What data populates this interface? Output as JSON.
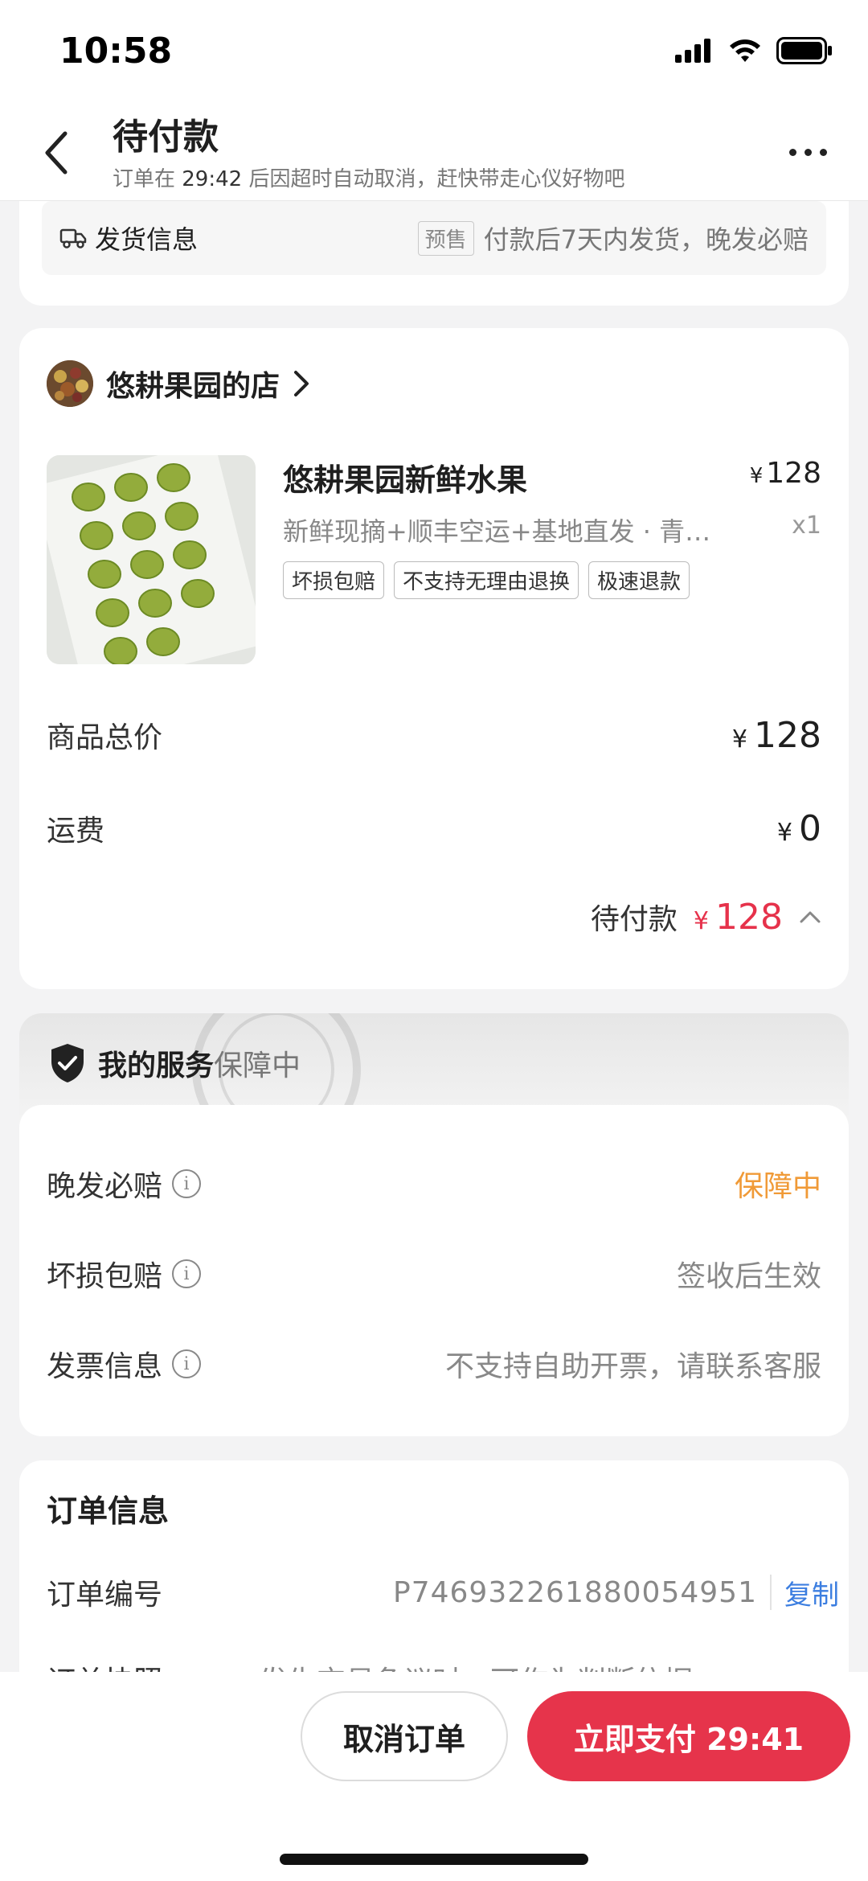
{
  "status_bar": {
    "time": "10:58"
  },
  "header": {
    "title": "待付款",
    "subtitle_prefix": "订单在 ",
    "subtitle_countdown": "29:42",
    "subtitle_suffix": " 后因超时自动取消，赶快带走心仪好物吧"
  },
  "shipping": {
    "label": "发货信息",
    "badge": "预售",
    "text": "付款后7天内发货，晚发必赔"
  },
  "shop": {
    "name": "悠耕果园的店",
    "product": {
      "title": "悠耕果园新鲜水果",
      "currency": "¥",
      "price": "128",
      "desc": "新鲜现摘+顺丰空运+基地直发 · 青皮无花果",
      "qty": "x1",
      "tags": [
        "坏损包赔",
        "不支持无理由退换",
        "极速退款"
      ]
    },
    "summary": {
      "total_label": "商品总价",
      "total_value": "128",
      "shipping_label": "运费",
      "shipping_value": "0",
      "pending_label": "待付款",
      "pending_value": "128",
      "currency": "¥"
    }
  },
  "service": {
    "title": "我的服务",
    "status": "保障中",
    "rows": [
      {
        "label": "晚发必赔",
        "value": "保障中"
      },
      {
        "label": "坏损包赔",
        "value": "签收后生效"
      },
      {
        "label": "发票信息",
        "value": "不支持自助开票，请联系客服"
      }
    ],
    "info_glyph": "i"
  },
  "order": {
    "title": "订单信息",
    "number_label": "订单编号",
    "number": "P746932261880054951",
    "copy": "复制",
    "snapshot_label": "订单快照",
    "snapshot_text": "发生交易争议时，可作为判断依据"
  },
  "actions": {
    "cancel": "取消订单",
    "pay": "立即支付 29:41"
  },
  "colors": {
    "accent_red": "#e6344b",
    "service_orange": "#f09a37",
    "link_blue": "#3c7ee0"
  }
}
